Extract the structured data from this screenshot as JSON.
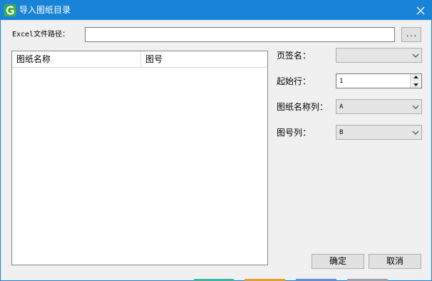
{
  "window": {
    "title": "导入图纸目录"
  },
  "form": {
    "path_label": "Excel文件路径：",
    "path_value": "",
    "browse_label": "...",
    "sheet_label": "页签名：",
    "sheet_value": "",
    "start_row_label": "起始行：",
    "start_row_value": "1",
    "name_col_label": "图纸名称列：",
    "name_col_value": "A",
    "number_col_label": "图号列：",
    "number_col_value": "B"
  },
  "list": {
    "columns": [
      "图纸名称",
      "图号"
    ],
    "rows": []
  },
  "buttons": {
    "ok": "确定",
    "cancel": "取消"
  },
  "colors": {
    "titlebar": "#1883d7",
    "background": "#f0f0f0"
  },
  "icons": [
    "app-logo-icon",
    "close-icon",
    "chevron-down-icon",
    "spin-up-icon",
    "spin-down-icon"
  ]
}
